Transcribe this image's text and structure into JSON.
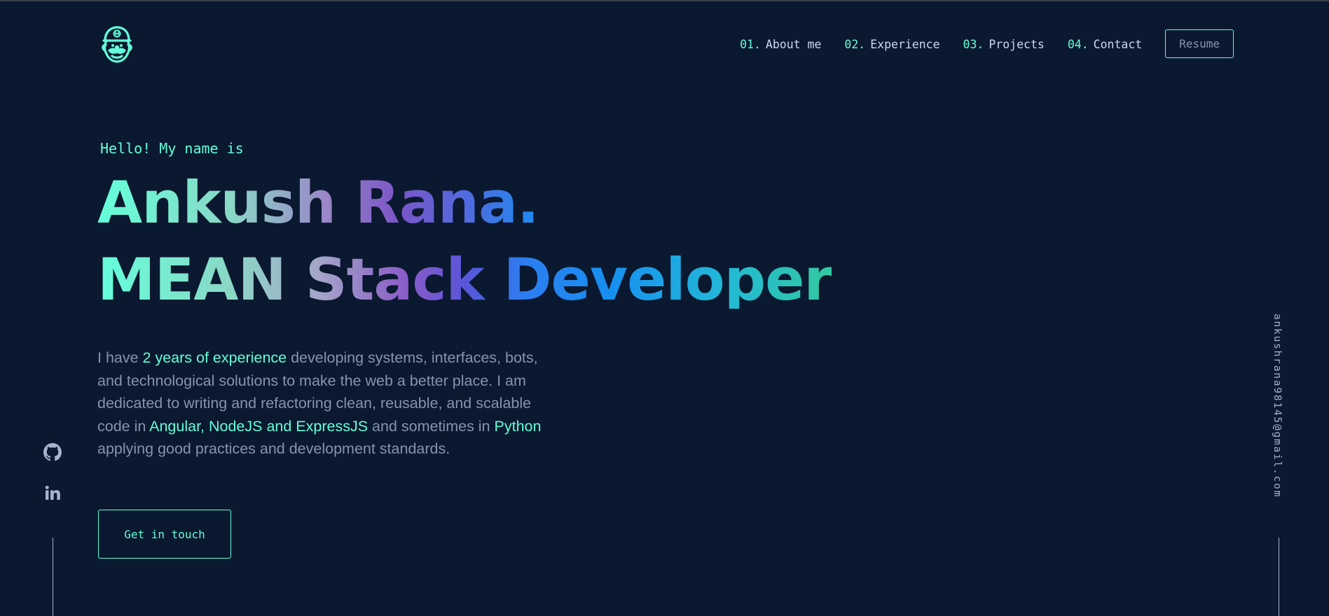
{
  "header": {
    "logo_icon": "mario-head-icon",
    "nav": [
      {
        "num": "01.",
        "label": "About me"
      },
      {
        "num": "02.",
        "label": "Experience"
      },
      {
        "num": "03.",
        "label": "Projects"
      },
      {
        "num": "04.",
        "label": "Contact"
      }
    ],
    "resume_label": "Resume"
  },
  "hero": {
    "greeting": "Hello! My name is",
    "name": "Ankush Rana.",
    "role": "MEAN Stack Developer",
    "bio": {
      "p1": "I have ",
      "h1": "2 years of experience",
      "p2": " developing systems, interfaces, bots, and technological solutions to make the web a better place. I am dedicated to writing and refactoring clean, reusable, and scalable code in ",
      "h2": "Angular, NodeJS and ExpressJS",
      "p3": " and sometimes in ",
      "h3": "Python",
      "p4": " applying good practices and development standards."
    },
    "cta_label": "Get in touch"
  },
  "social": {
    "github_icon": "github-icon",
    "linkedin_icon": "linkedin-icon"
  },
  "email": "ankushrana98145@gmail.com",
  "colors": {
    "background": "#0a192f",
    "accent": "#64ffda",
    "text": "#8892b0",
    "light_text": "#ccd6f6"
  }
}
